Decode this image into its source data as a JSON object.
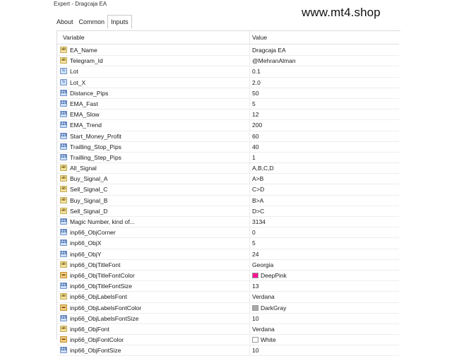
{
  "window": {
    "title": "Expert - Dragcaja EA"
  },
  "watermark": "www.mt4.shop",
  "tabs": [
    {
      "label": "About",
      "active": false
    },
    {
      "label": "Common",
      "active": false
    },
    {
      "label": "Inputs",
      "active": true
    }
  ],
  "table": {
    "headers": {
      "variable": "Variable",
      "value": "Value"
    },
    "rows": [
      {
        "icon": "string-icon",
        "name": "EA_Name",
        "value": "Dragcaja EA"
      },
      {
        "icon": "string-icon",
        "name": "Telegram_Id",
        "value": "@MehranAlman"
      },
      {
        "icon": "double-icon",
        "name": "Lot",
        "value": "0.1"
      },
      {
        "icon": "double-icon",
        "name": "Lot_X",
        "value": "2.0"
      },
      {
        "icon": "integer-icon",
        "name": "Distance_Pips",
        "value": "50"
      },
      {
        "icon": "integer-icon",
        "name": "EMA_Fast",
        "value": "5"
      },
      {
        "icon": "integer-icon",
        "name": "EMA_Slow",
        "value": "12"
      },
      {
        "icon": "integer-icon",
        "name": "EMA_Trend",
        "value": "200"
      },
      {
        "icon": "integer-icon",
        "name": "Start_Money_Profit",
        "value": "60"
      },
      {
        "icon": "integer-icon",
        "name": "Trailling_Stop_Pips",
        "value": "40"
      },
      {
        "icon": "integer-icon",
        "name": "Trailling_Step_Pips",
        "value": "1"
      },
      {
        "icon": "string-icon",
        "name": "All_Signal",
        "value": "A,B,C,D"
      },
      {
        "icon": "string-icon",
        "name": "Buy_Signal_A",
        "value": "A>B"
      },
      {
        "icon": "string-icon",
        "name": "Sell_Signal_C",
        "value": "C>D"
      },
      {
        "icon": "string-icon",
        "name": "Buy_Signal_B",
        "value": "B>A"
      },
      {
        "icon": "string-icon",
        "name": "Sell_Signal_D",
        "value": "D>C"
      },
      {
        "icon": "integer-icon",
        "name": "Magic Number, kind of...",
        "value": "3134"
      },
      {
        "icon": "integer-icon",
        "name": "inp66_ObjCorner",
        "value": "0"
      },
      {
        "icon": "integer-icon",
        "name": "inp66_ObjX",
        "value": "5"
      },
      {
        "icon": "integer-icon",
        "name": "inp66_ObjY",
        "value": "24"
      },
      {
        "icon": "string-icon",
        "name": "inp66_ObjTitleFont",
        "value": "Georgia"
      },
      {
        "icon": "color-icon",
        "name": "inp66_ObjTitleFontColor",
        "value": "DeepPink",
        "swatch": "#ff1493"
      },
      {
        "icon": "integer-icon",
        "name": "inp66_ObjTitleFontSize",
        "value": "13"
      },
      {
        "icon": "string-icon",
        "name": "inp66_ObjLabelsFont",
        "value": "Verdana"
      },
      {
        "icon": "color-icon",
        "name": "inp66_ObjLabelsFontColor",
        "value": "DarkGray",
        "swatch": "#a9a9a9"
      },
      {
        "icon": "integer-icon",
        "name": "inp66_ObjLabelsFontSize",
        "value": "10"
      },
      {
        "icon": "string-icon",
        "name": "inp66_ObjFont",
        "value": "Verdana"
      },
      {
        "icon": "color-icon",
        "name": "inp66_ObjFontColor",
        "value": "White",
        "swatch": "#ffffff"
      },
      {
        "icon": "integer-icon",
        "name": "inp66_ObjFontSize",
        "value": "10"
      }
    ]
  }
}
